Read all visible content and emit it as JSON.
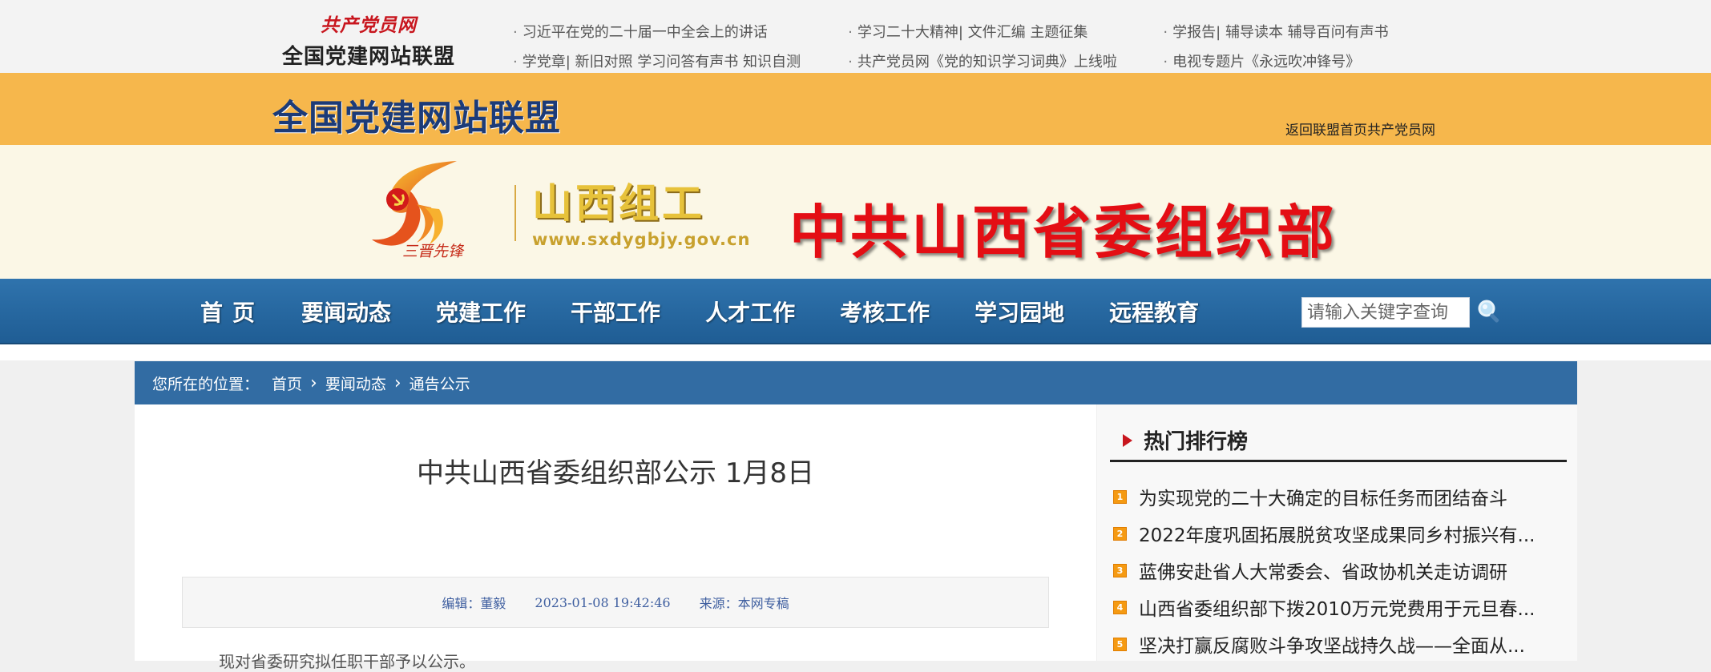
{
  "topbar": {
    "logo_sub": "共产党员网",
    "logo_main": "全国党建网站联盟",
    "links": [
      [
        "习近平在党的二十届一中全会上的讲话",
        "学习二十大精神| 文件汇编 主题征集",
        "学报告| 辅导读本 辅导百问有声书"
      ],
      [
        "学党章| 新旧对照 学习问答有声书 知识自测",
        "共产党员网《党的知识学习词典》上线啦",
        "电视专题片《永远吹冲锋号》"
      ]
    ]
  },
  "alliance": {
    "title": "全国党建网站联盟",
    "back_link": "返回联盟首页共产党员网"
  },
  "banner": {
    "emblem_caption": "三晋先锋",
    "brand_cn": "山西组工",
    "brand_url": "www.sxdygbjy.gov.cn",
    "org_name": "中共山西省委组织部",
    "colors": {
      "org_red": "#e40e14",
      "brand_gold": "#e7c23a"
    }
  },
  "nav": {
    "items": [
      "首页",
      "要闻动态",
      "党建工作",
      "干部工作",
      "人才工作",
      "考核工作",
      "学习园地",
      "远程教育"
    ],
    "search_placeholder": "请输入关键字查询",
    "search_icon": "magnifier-icon"
  },
  "breadcrumb": {
    "label": "您所在的位置：",
    "items": [
      "首页",
      "要闻动态",
      "通告公示"
    ]
  },
  "article": {
    "title": "中共山西省委组织部公示  1月8日",
    "editor": "编辑：董毅",
    "datetime": "2023-01-08 19:42:46",
    "source": "来源：本网专稿",
    "first_paragraph": "现对省委研究拟任职干部予以公示。"
  },
  "sidebar": {
    "heading": "热门排行榜",
    "items": [
      {
        "rank": "1",
        "text": "为实现党的二十大确定的目标任务而团结奋斗"
      },
      {
        "rank": "2",
        "text": "2022年度巩固拓展脱贫攻坚成果同乡村振兴有..."
      },
      {
        "rank": "3",
        "text": "蓝佛安赴省人大常委会、省政协机关走访调研"
      },
      {
        "rank": "4",
        "text": "山西省委组织部下拨2010万元党费用于元旦春..."
      },
      {
        "rank": "5",
        "text": "坚决打赢反腐败斗争攻坚战持久战——全面从..."
      }
    ]
  }
}
